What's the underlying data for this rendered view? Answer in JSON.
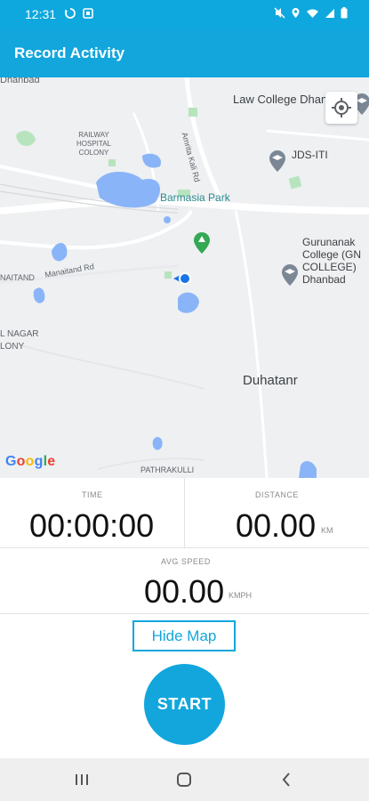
{
  "status_bar": {
    "time": "12:31",
    "left_icons": [
      "sync-icon",
      "screenshot-icon"
    ],
    "right_icons": [
      "mute-icon",
      "location-icon",
      "wifi-icon",
      "signal-icon",
      "battery-icon"
    ]
  },
  "app_bar": {
    "title": "Record Activity"
  },
  "map": {
    "labels": {
      "dhanbad_top": "Dhanbad",
      "law_college": "Law College Dhanba",
      "railway_colony": "RAILWAY\nHOSPITAL\nCOLONY",
      "jds_iti": "JDS-ITI",
      "amrita_rd": "Amrita Kali Rd",
      "barmasia_park": "Barmasia Park",
      "gurunanak": "Gurunanak\nCollege (GN\nCOLLEGE)\nDhanbad",
      "manaitand_rd": "Manaitand Rd",
      "naitand": "NAITAND",
      "nagar_colony": "L NAGAR\nLONY",
      "duhatanr": "Duhatanr",
      "pathrakulli": "PATHRAKULLI"
    },
    "google_logo": [
      "G",
      "o",
      "o",
      "g",
      "l",
      "e"
    ],
    "icons": {
      "locate": "my-location-icon",
      "park": "park-pin-icon",
      "school_1": "school-pin-icon",
      "school_2": "school-pin-icon",
      "school_3": "school-pin-icon",
      "user": "user-location-icon"
    },
    "colors": {
      "water": "#8ab4f8",
      "green": "#b7e4bd",
      "road": "#ffffff",
      "background": "#eef0f2",
      "user_dot": "#1a73e8"
    }
  },
  "stats": {
    "time": {
      "label": "TIME",
      "value": "00:00:00"
    },
    "distance": {
      "label": "DISTANCE",
      "value": "00.00",
      "unit": "KM"
    },
    "avg_speed": {
      "label": "AVG SPEED",
      "value": "00.00",
      "unit": "KMPH"
    }
  },
  "actions": {
    "hide_map": "Hide Map",
    "start": "START"
  },
  "nav_bar": {
    "recents": "recents-icon",
    "home": "home-icon",
    "back": "back-icon"
  },
  "colors": {
    "accent": "#12a6dc",
    "status_bar": "#0fa8de",
    "text_muted": "#8a8a8a"
  }
}
